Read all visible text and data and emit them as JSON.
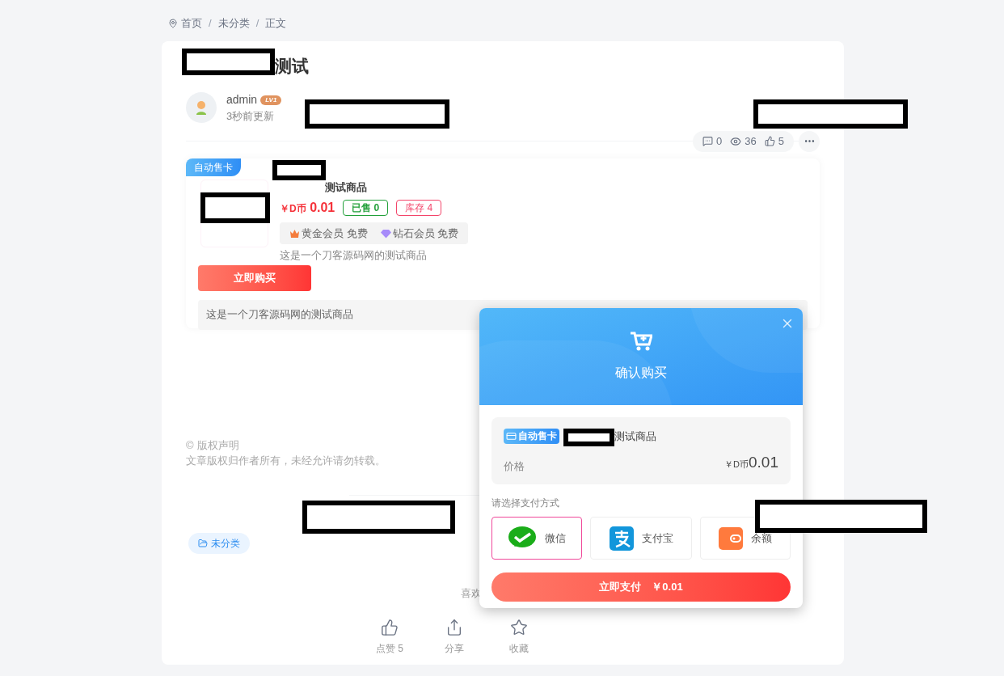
{
  "breadcrumb": [
    "首页",
    "未分类",
    "正文"
  ],
  "breadcrumb_separator": "/",
  "article": {
    "title": "测试",
    "author": "admin",
    "level_badge": "LV1",
    "updated": "3秒前更新",
    "stats": {
      "comments": "0",
      "views": "36",
      "likes": "5"
    }
  },
  "product": {
    "badge": "自动售卡",
    "name": "测试商品",
    "price_prefix": "￥D币",
    "price": "0.01",
    "sold": "已售 0",
    "stock": "库存 4",
    "members": [
      {
        "kind": "gold",
        "label": "黄金会员 免费"
      },
      {
        "kind": "diamond",
        "label": "钻石会员 免费"
      }
    ],
    "summary": "这是一个刀客源码网的测试商品",
    "buy_button": "立即购买",
    "description": "这是一个刀客源码网的测试商品"
  },
  "copyright": {
    "symbol": "©",
    "title": "版权声明",
    "text": "文章版权归作者所有，未经允许请勿转载。"
  },
  "tag": "未分类",
  "like_prompt": "喜欢",
  "actions": [
    {
      "kind": "like",
      "label": "点赞 5"
    },
    {
      "kind": "share",
      "label": "分享"
    },
    {
      "kind": "favorite",
      "label": "收藏"
    }
  ],
  "dialog": {
    "title": "确认购买",
    "badge": "自动售卡",
    "product_name": "测试商品",
    "price_label": "价格",
    "price_prefix": "￥D币",
    "price": "0.01",
    "payment_prompt": "请选择支付方式",
    "payment_methods": [
      {
        "kind": "wechat",
        "label": "微信",
        "selected": true
      },
      {
        "kind": "alipay",
        "label": "支付宝",
        "selected": false
      },
      {
        "kind": "balance",
        "label": "余额",
        "selected": false
      }
    ],
    "pay_button": "立即支付　￥0.01"
  }
}
